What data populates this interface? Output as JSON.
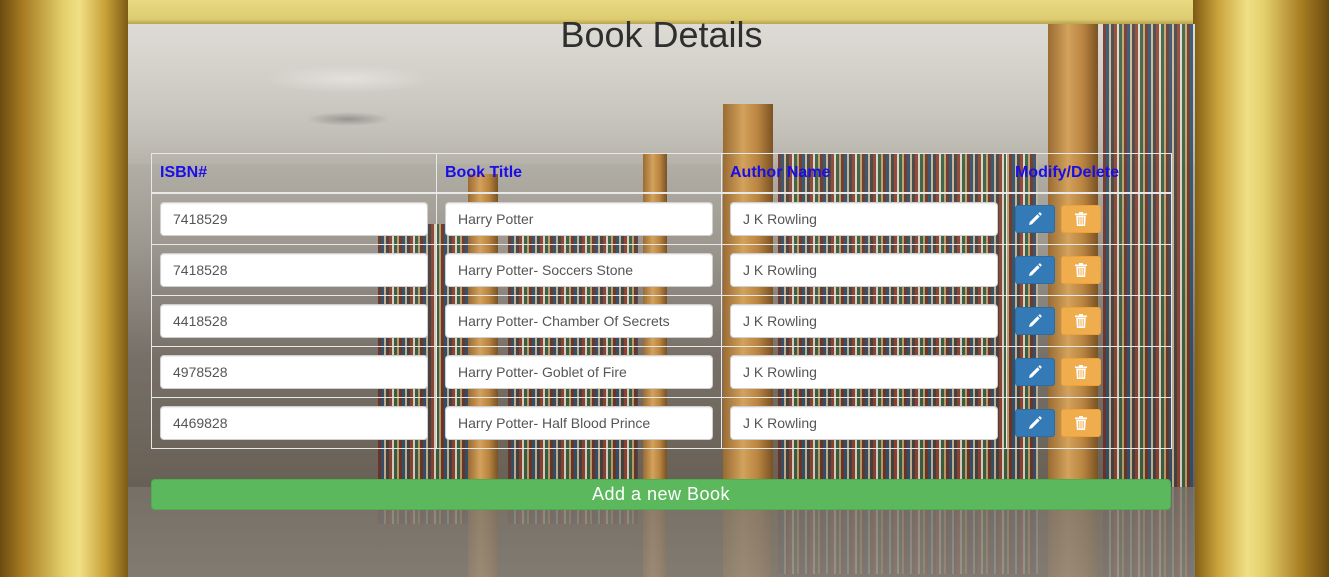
{
  "page": {
    "title": "Book Details"
  },
  "table": {
    "headers": {
      "isbn": "ISBN#",
      "title": "Book Title",
      "author": "Author Name",
      "actions": "Modify/Delete"
    },
    "rows": [
      {
        "isbn": "7418529",
        "title": "Harry Potter",
        "author": "J K Rowling"
      },
      {
        "isbn": "7418528",
        "title": "Harry Potter- Soccers Stone",
        "author": "J K Rowling"
      },
      {
        "isbn": "4418528",
        "title": "Harry Potter- Chamber Of Secrets",
        "author": "J K Rowling"
      },
      {
        "isbn": "4978528",
        "title": "Harry Potter- Goblet of Fire",
        "author": "J K Rowling"
      },
      {
        "isbn": "4469828",
        "title": "Harry Potter- Half Blood Prince",
        "author": "J K Rowling"
      }
    ],
    "row_actions": {
      "edit_icon": "pencil-icon",
      "delete_icon": "trash-icon"
    }
  },
  "footer": {
    "add_label": "Add a new Book"
  },
  "colors": {
    "header_text": "#1a0de6",
    "edit_button": "#337ab7",
    "delete_button": "#f0ad4e",
    "add_button": "#5cb85c"
  }
}
